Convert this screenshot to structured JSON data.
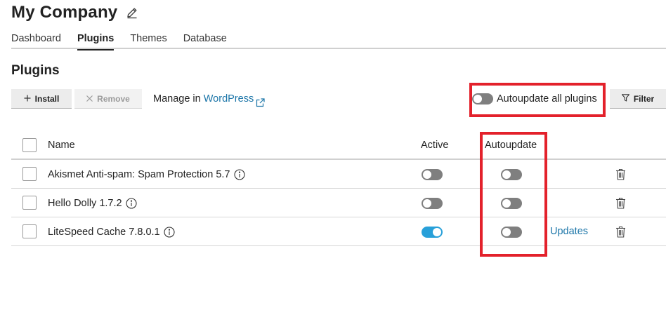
{
  "header": {
    "title": "My Company",
    "edit_icon": "pencil-icon"
  },
  "tabs": [
    {
      "label": "Dashboard",
      "active": false
    },
    {
      "label": "Plugins",
      "active": true
    },
    {
      "label": "Themes",
      "active": false
    },
    {
      "label": "Database",
      "active": false
    }
  ],
  "section": {
    "title": "Plugins"
  },
  "toolbar": {
    "install_label": "Install",
    "remove_label": "Remove",
    "manage_prefix": "Manage in ",
    "manage_link": "WordPress",
    "autoupdate_all_label": "Autoupdate all plugins",
    "autoupdate_all_on": false,
    "filter_label": "Filter"
  },
  "table": {
    "columns": {
      "name": "Name",
      "active": "Active",
      "autoupdate": "Autoupdate"
    },
    "rows": [
      {
        "name": "Akismet Anti-spam: Spam Protection 5.7",
        "active": false,
        "autoupdate": false,
        "updates": ""
      },
      {
        "name": "Hello Dolly 1.7.2",
        "active": false,
        "autoupdate": false,
        "updates": ""
      },
      {
        "name": "LiteSpeed Cache 7.8.0.1",
        "active": true,
        "autoupdate": false,
        "updates": "Updates"
      }
    ]
  },
  "colors": {
    "link": "#1b75a8",
    "toggle_on": "#28a0d9",
    "toggle_off": "#7f7f7f",
    "highlight": "#e3212b"
  }
}
